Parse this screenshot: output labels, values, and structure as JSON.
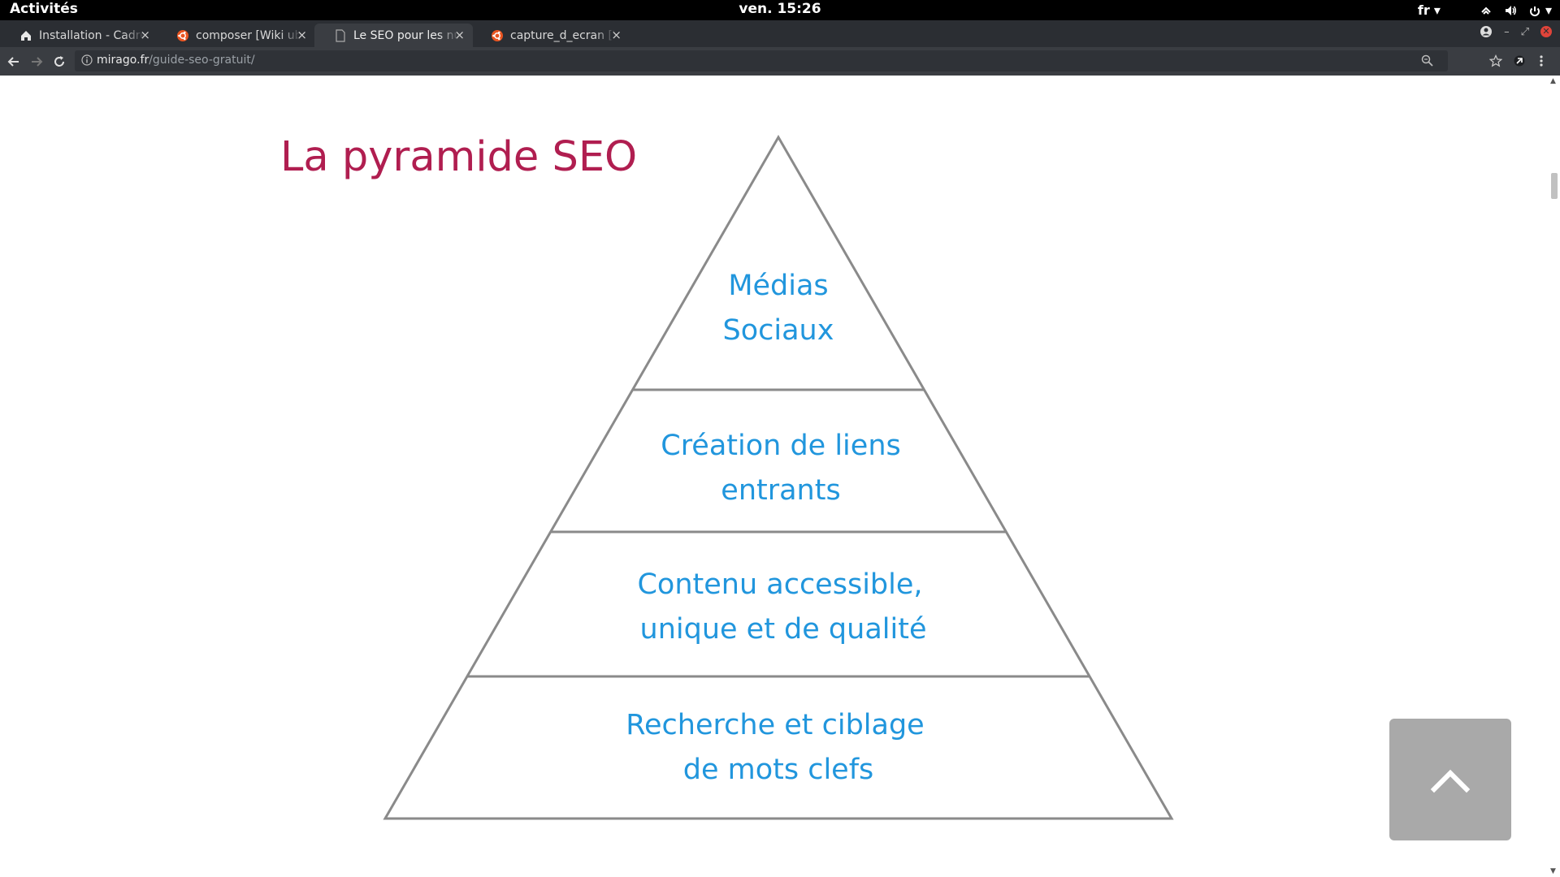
{
  "system_bar": {
    "activities": "Activités",
    "clock": "ven. 15:26",
    "language": "fr"
  },
  "browser": {
    "tabs": [
      {
        "title": "Installation - Cadre",
        "icon": "home-favicon",
        "active": false
      },
      {
        "title": "composer [Wiki ubu",
        "icon": "ubuntu-favicon",
        "active": false
      },
      {
        "title": "Le SEO pour les nul",
        "icon": "page-favicon",
        "active": true
      },
      {
        "title": "capture_d_ecran [W",
        "icon": "ubuntu-favicon",
        "active": false
      }
    ],
    "close_glyph": "×",
    "url": {
      "host": "mirago.fr",
      "path": "/guide-seo-gratuit/"
    }
  },
  "page": {
    "pyramid_title": "La pyramide SEO",
    "levels": [
      {
        "line1": "Médias",
        "line2": "Sociaux"
      },
      {
        "line1": "Création de liens",
        "line2": "entrants"
      },
      {
        "line1": "Contenu accessible,",
        "line2": "unique et de qualité"
      },
      {
        "line1": "Recherche et ciblage",
        "line2": "de mots clefs"
      }
    ]
  },
  "colors": {
    "title": "#b01e50",
    "level_text": "#2196dd",
    "pyramid_stroke": "#8a8a8a",
    "scroll_top_button": "#a9a9a9"
  }
}
